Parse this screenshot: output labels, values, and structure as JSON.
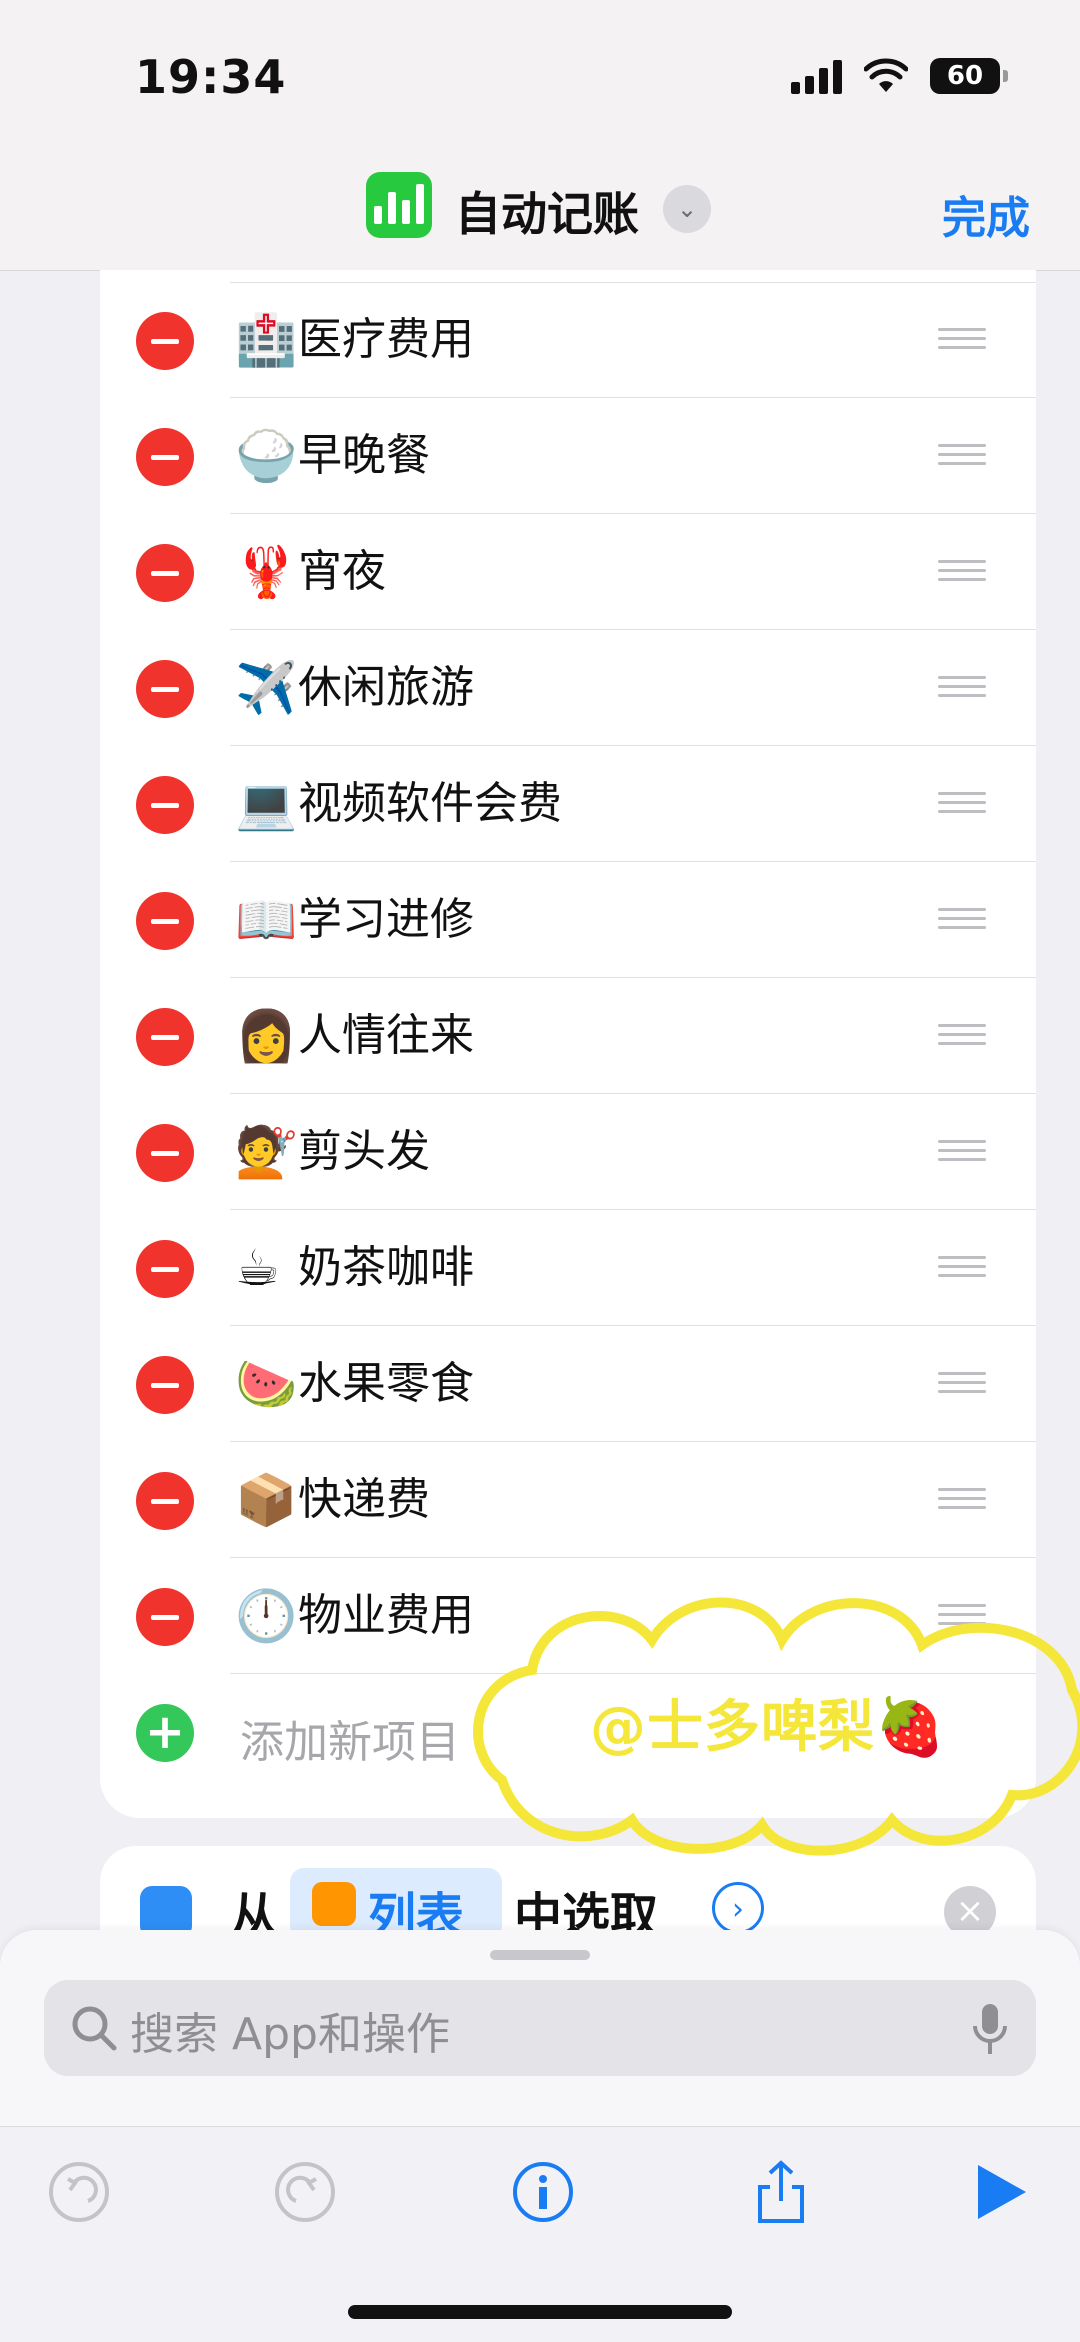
{
  "status_bar": {
    "time": "19:34",
    "battery": "60"
  },
  "header": {
    "title": "自动记账",
    "done_label": "完成"
  },
  "list": {
    "items": [
      {
        "emoji": "🏥",
        "label": "医疗费用"
      },
      {
        "emoji": "🍚",
        "label": "早晚餐"
      },
      {
        "emoji": "🦞",
        "label": "宵夜"
      },
      {
        "emoji": "✈️",
        "label": "休闲旅游"
      },
      {
        "emoji": "💻",
        "label": "视频软件会费"
      },
      {
        "emoji": "📖",
        "label": "学习进修"
      },
      {
        "emoji": "👩",
        "label": "人情往来"
      },
      {
        "emoji": "💇",
        "label": "剪头发"
      },
      {
        "emoji": "☕",
        "label": "奶茶咖啡"
      },
      {
        "emoji": "🍉",
        "label": "水果零食"
      },
      {
        "emoji": "📦",
        "label": "快递费"
      },
      {
        "emoji": "🕛",
        "label": "物业费用"
      }
    ],
    "add_label": "添加新项目"
  },
  "next_action": {
    "from": "从",
    "chip": "列表",
    "rest": "中选取"
  },
  "search": {
    "placeholder": "搜索 App和操作"
  },
  "watermark": "@士多啤梨🍓",
  "colors": {
    "accent": "#1a7cf2",
    "remove": "#f0332d",
    "add": "#34c759",
    "app_icon": "#27c93f"
  },
  "icons": {
    "toolbar": [
      "undo-icon",
      "redo-icon",
      "info-icon",
      "share-icon",
      "play-icon"
    ]
  }
}
